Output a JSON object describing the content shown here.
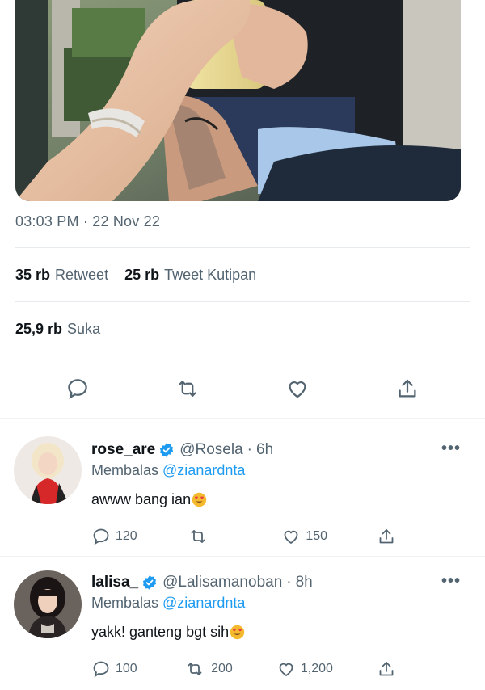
{
  "tweet": {
    "timestamp": "03:03 PM · 22 Nov 22",
    "retweets": {
      "count": "35 rb",
      "label": "Retweet"
    },
    "quotes": {
      "count": "25 rb",
      "label": "Tweet Kutipan"
    },
    "likes": {
      "count": "25,9 rb",
      "label": "Suka"
    },
    "icons": [
      "reply-icon",
      "retweet-icon",
      "like-icon",
      "share-icon"
    ]
  },
  "replies": [
    {
      "name": "rose_are",
      "handle": "@Rosela",
      "dot": "·",
      "time": "6h",
      "replying_label": "Membalas",
      "replying_to": "@zianardnta",
      "text": "awww bang ian",
      "reply_count": "120",
      "retweet_count": "",
      "like_count": "150",
      "more": "•••"
    },
    {
      "name": "lalisa_",
      "handle": "@Lalisamanoban",
      "dot": "·",
      "time": "8h",
      "replying_label": "Membalas",
      "replying_to": "@zianardnta",
      "text": "yakk! ganteng bgt sih",
      "reply_count": "100",
      "retweet_count": "200",
      "like_count": "1,200",
      "more": "•••"
    }
  ],
  "colors": {
    "accent": "#1d9bf0",
    "secondary_text": "#536471",
    "primary_text": "#0f1419"
  }
}
